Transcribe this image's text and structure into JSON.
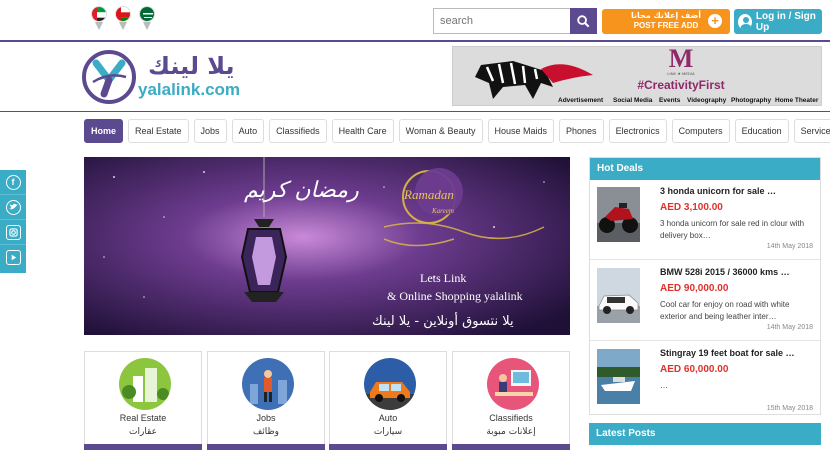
{
  "flags": [
    {
      "name": "uae-flag-icon"
    },
    {
      "name": "oman-flag-icon"
    },
    {
      "name": "saudi-flag-icon"
    }
  ],
  "search": {
    "placeholder": "search"
  },
  "header": {
    "post_ad_ar": "أضف إعلانك مجانا",
    "post_ad_en": "POST FREE ADD",
    "login": "Log in / Sign Up"
  },
  "logo": {
    "ar": "يلا لينك",
    "en": "yalalink.com"
  },
  "ad_banner": {
    "brand_letter": "M",
    "brand_sub": "LINK ★ MEDIA",
    "hashtag": "#CreativityFirst",
    "services": [
      "Advertisement",
      "Social Media",
      "Events",
      "Videography",
      "Photography",
      "Home Theater"
    ]
  },
  "nav": {
    "items": [
      "Home",
      "Real Estate",
      "Jobs",
      "Auto",
      "Classifieds",
      "Health Care",
      "Woman & Beauty",
      "House Maids",
      "Phones",
      "Electronics",
      "Computers",
      "Education",
      "Services"
    ]
  },
  "hero": {
    "script_ar": "رمضان كريم",
    "ramadan": "Ramadan",
    "kareem": "Kareem",
    "line1": "Lets Link",
    "line2": "& Online Shopping yalalink",
    "line3_ar": "يلا نتسوق أونلاين - يلا لينك"
  },
  "categories": [
    {
      "en": "Real Estate",
      "ar": "عقارات"
    },
    {
      "en": "Jobs",
      "ar": "وظائف"
    },
    {
      "en": "Auto",
      "ar": "سيارات"
    },
    {
      "en": "Classifieds",
      "ar": "إعلانات مبوبة"
    }
  ],
  "hot_deals": {
    "title": "Hot Deals",
    "items": [
      {
        "title": "3 honda unicorn for sale …",
        "price": "AED 3,100.00",
        "desc": "3 honda unicorn for sale red in clour with delivery box…",
        "date": "14th May 2018"
      },
      {
        "title": "BMW 528i 2015 / 36000 kms …",
        "price": "AED 90,000.00",
        "desc": "Cool car for enjoy on road with white exterior and being leather inter…",
        "date": "14th May 2018"
      },
      {
        "title": "Stingray 19 feet boat for sale …",
        "price": "AED 60,000.00",
        "desc": "…",
        "date": "15th May 2018"
      }
    ]
  },
  "latest_posts": {
    "title": "Latest Posts"
  },
  "social": [
    "f",
    "t",
    "ig",
    "yt"
  ],
  "colors": {
    "purple": "#5b4a8f",
    "teal": "#3aacc5",
    "orange": "#f7941d",
    "price_red": "#e0312b"
  }
}
